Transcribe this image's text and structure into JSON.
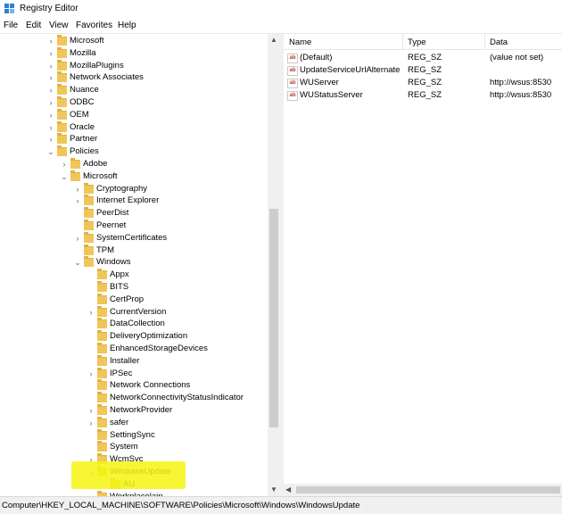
{
  "window": {
    "title": "Registry Editor"
  },
  "menu": [
    "File",
    "Edit",
    "View",
    "Favorites",
    "Help"
  ],
  "tree": [
    {
      "label": "Microsoft",
      "level": 0,
      "exp": ">"
    },
    {
      "label": "Mozilla",
      "level": 0,
      "exp": ">"
    },
    {
      "label": "MozillaPlugins",
      "level": 0,
      "exp": ">"
    },
    {
      "label": "Network Associates",
      "level": 0,
      "exp": ">"
    },
    {
      "label": "Nuance",
      "level": 0,
      "exp": ">"
    },
    {
      "label": "ODBC",
      "level": 0,
      "exp": ">"
    },
    {
      "label": "OEM",
      "level": 0,
      "exp": ">"
    },
    {
      "label": "Oracle",
      "level": 0,
      "exp": ">"
    },
    {
      "label": "Partner",
      "level": 0,
      "exp": ">"
    },
    {
      "label": "Policies",
      "level": 0,
      "exp": "v"
    },
    {
      "label": "Adobe",
      "level": 1,
      "exp": ">"
    },
    {
      "label": "Microsoft",
      "level": 1,
      "exp": "v"
    },
    {
      "label": "Cryptography",
      "level": 2,
      "exp": ">"
    },
    {
      "label": "Internet Explorer",
      "level": 2,
      "exp": ">"
    },
    {
      "label": "PeerDist",
      "level": 2,
      "exp": ""
    },
    {
      "label": "Peernet",
      "level": 2,
      "exp": ""
    },
    {
      "label": "SystemCertificates",
      "level": 2,
      "exp": ">"
    },
    {
      "label": "TPM",
      "level": 2,
      "exp": ""
    },
    {
      "label": "Windows",
      "level": 2,
      "exp": "v"
    },
    {
      "label": "Appx",
      "level": 3,
      "exp": ""
    },
    {
      "label": "BITS",
      "level": 3,
      "exp": ""
    },
    {
      "label": "CertProp",
      "level": 3,
      "exp": ""
    },
    {
      "label": "CurrentVersion",
      "level": 3,
      "exp": ">"
    },
    {
      "label": "DataCollection",
      "level": 3,
      "exp": ""
    },
    {
      "label": "DeliveryOptimization",
      "level": 3,
      "exp": ""
    },
    {
      "label": "EnhancedStorageDevices",
      "level": 3,
      "exp": ""
    },
    {
      "label": "Installer",
      "level": 3,
      "exp": ""
    },
    {
      "label": "IPSec",
      "level": 3,
      "exp": ">"
    },
    {
      "label": "Network Connections",
      "level": 3,
      "exp": ""
    },
    {
      "label": "NetworkConnectivityStatusIndicator",
      "level": 3,
      "exp": ""
    },
    {
      "label": "NetworkProvider",
      "level": 3,
      "exp": ">"
    },
    {
      "label": "safer",
      "level": 3,
      "exp": ">"
    },
    {
      "label": "SettingSync",
      "level": 3,
      "exp": ""
    },
    {
      "label": "System",
      "level": 3,
      "exp": ""
    },
    {
      "label": "WcmSvc",
      "level": 3,
      "exp": ">"
    },
    {
      "label": "WindowsUpdate",
      "level": 3,
      "exp": "v",
      "selected": true
    },
    {
      "label": "AU",
      "level": 4,
      "exp": ""
    },
    {
      "label": "Workplacelain",
      "level": 3,
      "exp": ">"
    }
  ],
  "list": {
    "columns": [
      "Name",
      "Type",
      "Data"
    ],
    "rows": [
      {
        "name": "(Default)",
        "type": "REG_SZ",
        "data": "(value not set)"
      },
      {
        "name": "UpdateServiceUrlAlternate",
        "type": "REG_SZ",
        "data": ""
      },
      {
        "name": "WUServer",
        "type": "REG_SZ",
        "data": "http://wsus:8530"
      },
      {
        "name": "WUStatusServer",
        "type": "REG_SZ",
        "data": "http://wsus:8530"
      }
    ]
  },
  "status": {
    "path": "Computer\\HKEY_LOCAL_MACHINE\\SOFTWARE\\Policies\\Microsoft\\Windows\\WindowsUpdate"
  },
  "colors": {
    "folder": "#f0c65a",
    "highlight": "#f4f40e",
    "value_icon": "#c0392b"
  }
}
